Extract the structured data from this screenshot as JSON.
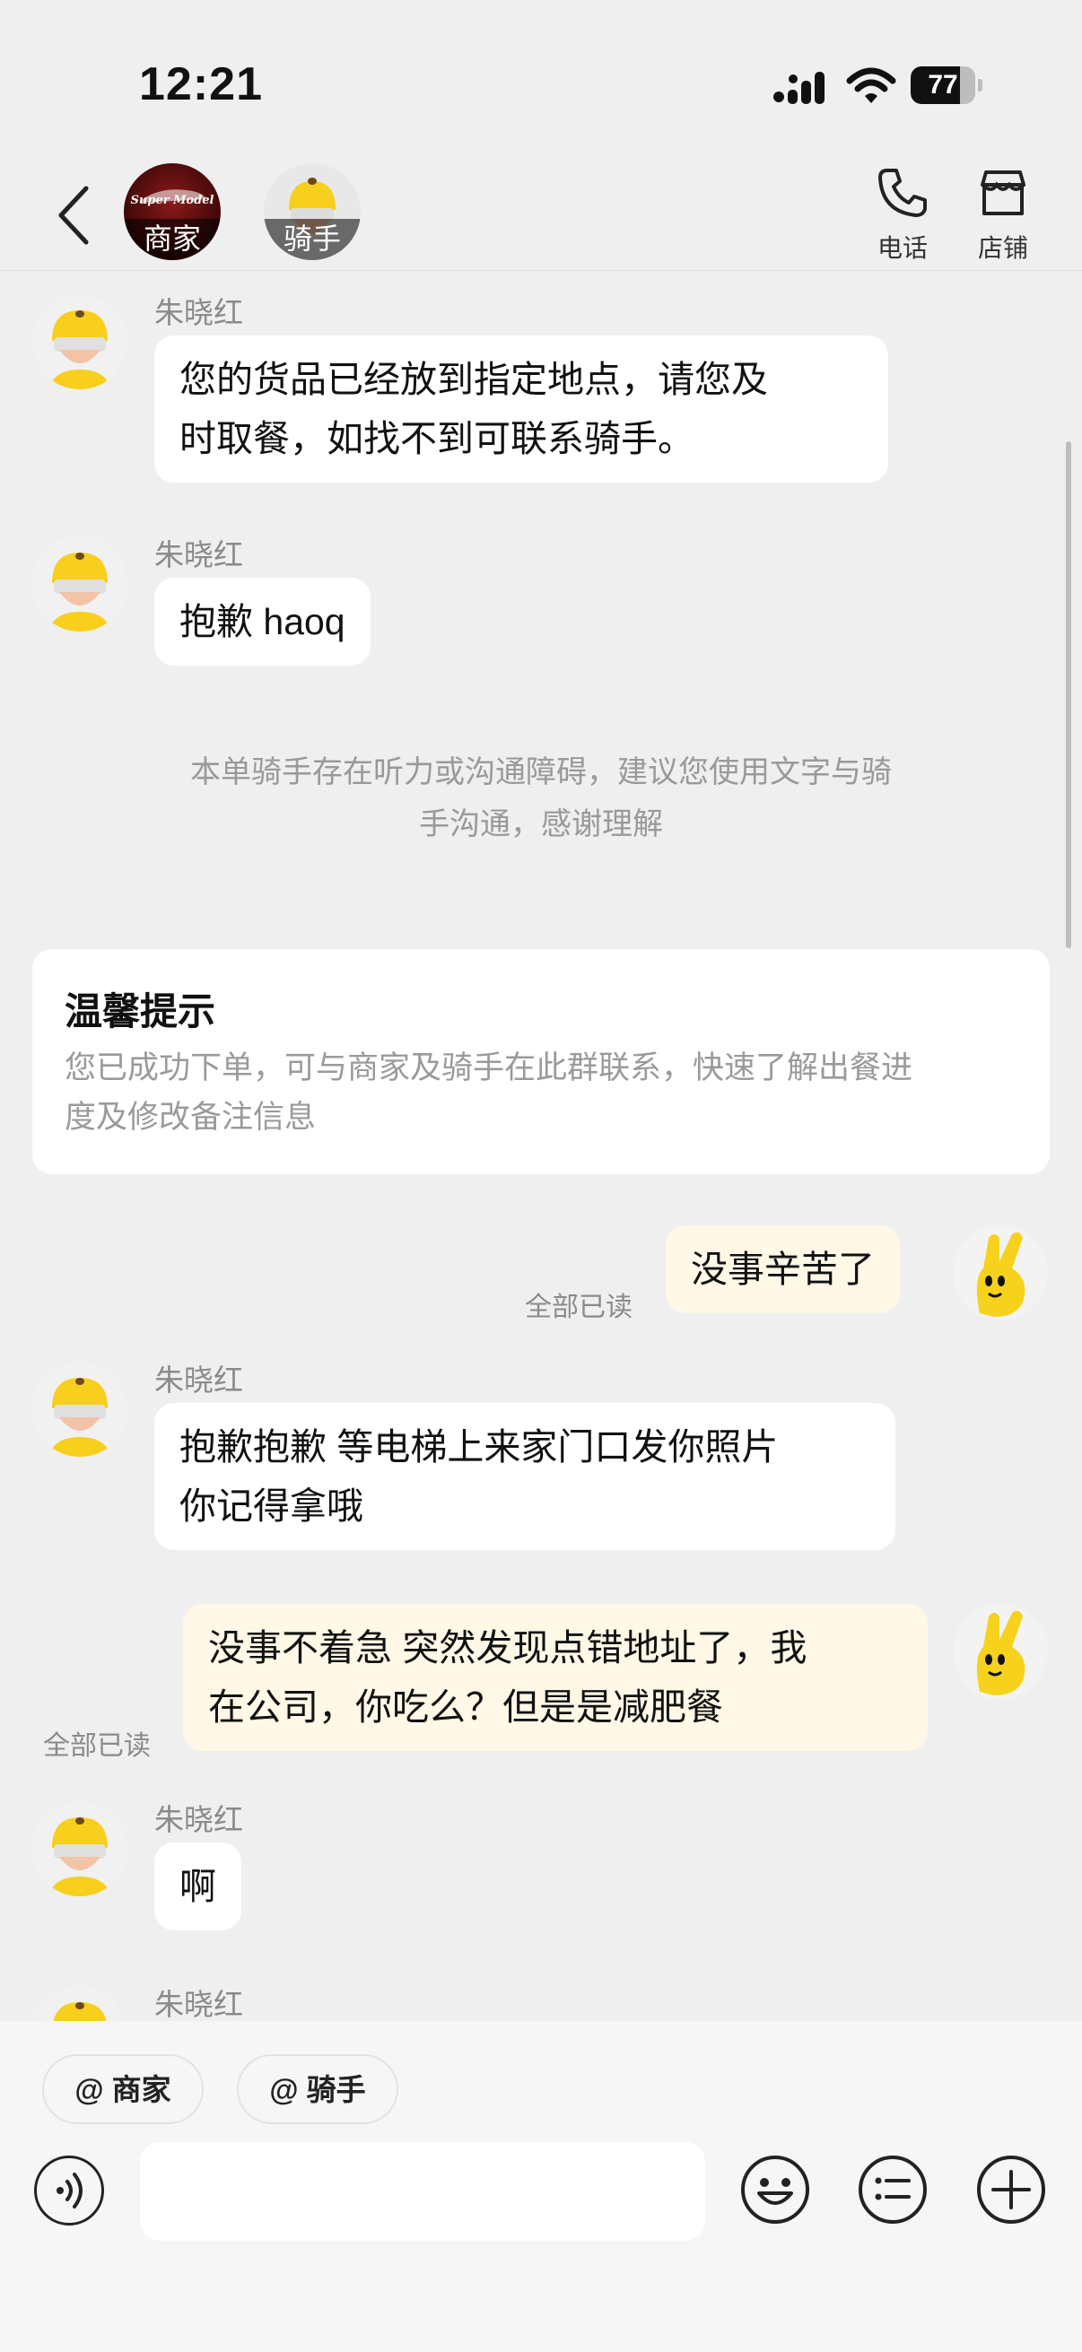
{
  "status_bar": {
    "time": "12:21",
    "battery": "77",
    "battery_level": 0.77
  },
  "header": {
    "merchant_brand": "Super Model",
    "merchant_label": "商家",
    "rider_label": "骑手",
    "call_label": "电话",
    "store_label": "店铺"
  },
  "messages": [
    {
      "sender": "朱晓红",
      "text_lines": [
        "您的货品已经放到指定地点，请您及",
        "时取餐，如找不到可联系骑手。"
      ]
    },
    {
      "sender": "朱晓红",
      "text": "抱歉 haoq"
    },
    {
      "system_lines": [
        "本单骑手存在听力或沟通障碍，建议您使用文字与骑",
        "手沟通，感谢理解"
      ]
    },
    {
      "tip_title": "温馨提示",
      "tip_lines": [
        "您已成功下单，可与商家及骑手在此群联系，快速了解出餐进",
        "度及修改备注信息"
      ]
    },
    {
      "mine": true,
      "text": "没事辛苦了",
      "read": "全部已读"
    },
    {
      "sender": "朱晓红",
      "text_lines": [
        "抱歉抱歉 等电梯上来家门口发你照片",
        "你记得拿哦"
      ]
    },
    {
      "mine": true,
      "text_lines": [
        "没事不着急 突然发现点错地址了，我",
        "在公司，你吃么？但是是减肥餐"
      ],
      "read": "全部已读"
    },
    {
      "sender": "朱晓红",
      "text": "啊"
    },
    {
      "sender": "朱晓红"
    }
  ],
  "bottom_bar": {
    "mention_merchant": "@ 商家",
    "mention_rider": "@ 骑手"
  }
}
